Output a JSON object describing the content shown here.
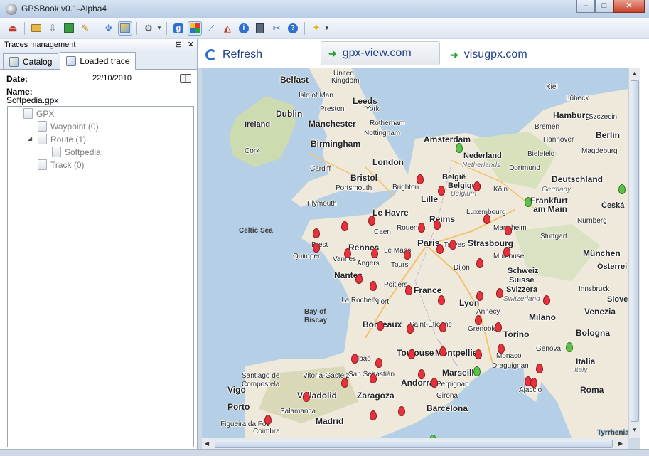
{
  "window": {
    "title": "GPSBook v0.1-Alpha4",
    "controls": {
      "minimize": "–",
      "maximize": "□",
      "close": "✕"
    }
  },
  "toolbar": {
    "buttons": [
      {
        "name": "exit-icon",
        "glyph": "⏏",
        "color": "#c0392b"
      },
      {
        "name": "open-folder-icon",
        "glyph": "▭",
        "color": "#d9a441"
      },
      {
        "name": "import-icon",
        "glyph": "⇩",
        "color": "#6b7c8f"
      },
      {
        "name": "export-icon",
        "glyph": "⇧",
        "color": "#2e8b3c"
      },
      {
        "name": "clean-icon",
        "glyph": "✎",
        "color": "#c98a1b"
      },
      {
        "name": "move-icon",
        "glyph": "✥",
        "color": "#2e6fd0"
      },
      {
        "name": "map-view-icon",
        "glyph": "▦",
        "color": "#d1a21b"
      },
      {
        "name": "plugins-icon",
        "glyph": "⚙",
        "color": "#555555"
      },
      {
        "name": "google-icon",
        "glyph": "g",
        "color": "#2e6fd0"
      },
      {
        "name": "tiles-icon",
        "glyph": "▩",
        "color": "#2aa336"
      },
      {
        "name": "chart-icon",
        "glyph": "📈",
        "color": "#2e6fd0"
      },
      {
        "name": "routes-icon",
        "glyph": "◭",
        "color": "#c0392b"
      },
      {
        "name": "info-icon",
        "glyph": "ℹ",
        "color": "#2e6fd0"
      },
      {
        "name": "calculator-icon",
        "glyph": "▤",
        "color": "#4a5866"
      },
      {
        "name": "tools-icon",
        "glyph": "✂",
        "color": "#4a77b6"
      },
      {
        "name": "help-icon",
        "glyph": "?",
        "color": "#2e6fd0"
      },
      {
        "name": "star-icon",
        "glyph": "✦",
        "color": "#e6b41a"
      }
    ]
  },
  "panel": {
    "title": "Traces management",
    "tabs": [
      {
        "label": "Catalog"
      },
      {
        "label": "Loaded trace"
      }
    ],
    "date_label": "Date:",
    "date_value": "22/10/2010",
    "name_label": "Name:",
    "name_value": "Softpedia.gpx",
    "tree": [
      {
        "label": "GPX"
      },
      {
        "label": "Waypoint (0)"
      },
      {
        "label": "Route (1)"
      },
      {
        "label": "Softpedia"
      },
      {
        "label": "Track (0)"
      }
    ]
  },
  "nav": {
    "refresh": "Refresh",
    "link1": "gpx-view.com",
    "link2": "visugpx.com"
  },
  "map": {
    "colors": {
      "sea": "#b5cfe6",
      "land": "#eee9da",
      "forest": "#cddbb0",
      "marker_red": "#e5323b",
      "marker_green": "#5ec24a"
    },
    "labels": {
      "united_kingdom": "United",
      "kingdom": "Kingdom",
      "belfast": "Belfast",
      "isle_of_man": "Isle of Man",
      "leeds": "Leeds",
      "preston": "Preston",
      "york": "York",
      "dublin": "Dublin",
      "ireland": "Ireland",
      "manchester": "Manchester",
      "rotherham": "Rotherham",
      "nottingham": "Nottingham",
      "cork": "Cork",
      "birmingham": "Birmingham",
      "cardiff": "Cardiff",
      "london": "London",
      "bristol": "Bristol",
      "portsmouth": "Portsmouth",
      "brighton": "Brighton",
      "plymouth": "Plymouth",
      "celtic_sea": "Celtic Sea",
      "amsterdam": "Amsterdam",
      "nederland": "Nederland",
      "netherlands": "Netherlands",
      "belgie": "België",
      "belgique": "Belgique",
      "belgium": "Belgium",
      "lille": "Lille",
      "koln": "Köln",
      "dortmund": "Dortmund",
      "bielefeld": "Bielefeld",
      "hamburg": "Hamburg",
      "kiel": "Kiel",
      "lubeck": "Lübeck",
      "bremen": "Bremen",
      "hannover": "Hannover",
      "berlin": "Berlin",
      "szczecin": "Szczecin",
      "magdeburg": "Magdeburg",
      "deutschland": "Deutschland",
      "germany": "Germany",
      "frankfurt": "Frankfurt",
      "am_main": "am Main",
      "ceska": "Česká",
      "luxembourg": "Luxembourg",
      "mannheim": "Mannheim",
      "nurnberg": "Nürnberg",
      "stuttgart": "Stuttgart",
      "munchen": "München",
      "osterreich": "Österrei",
      "schweiz": "Schweiz",
      "suisse": "Suisse",
      "svizzera": "Svizzera",
      "innsbruck": "Innsbruck",
      "switzerland": "Switzerland",
      "strasbourg": "Strasbourg",
      "mulhouse": "Mulhouse",
      "reims": "Reims",
      "paris": "Paris",
      "troyes": "Troyes",
      "le_havre": "Le Havre",
      "caen": "Caen",
      "rouen": "Rouen",
      "rennes": "Rennes",
      "le_mans": "Le Mans",
      "brest": "Brest",
      "quimper": "Quimper",
      "vannes": "Vannes",
      "angers": "Angers",
      "tours": "Tours",
      "nantes": "Nantes",
      "dijon": "Dijon",
      "france": "France",
      "poitiers": "Poitiers",
      "la_rochelle": "La Rochelle",
      "niort": "Niort",
      "lyon": "Lyon",
      "annecy": "Annecy",
      "bay_of_biscay_1": "Bay of",
      "bay_of_biscay_2": "Biscay",
      "bordeaux": "Bordeaux",
      "saint_etienne": "Saint-Étienne",
      "grenoble": "Grenoble",
      "milano": "Milano",
      "torino": "Torino",
      "venezia": "Venezia",
      "slove": "Slove",
      "genova": "Genova",
      "bologna": "Bologna",
      "monaco": "Monaco",
      "toulouse": "Toulouse",
      "montpellier": "Montpellier",
      "marseille": "Marseille",
      "draguignan": "Draguignan",
      "italia": "Italia",
      "italy": "Italy",
      "ajaccio": "Ajaccio",
      "roma": "Roma",
      "bilbao": "Bilbao",
      "san_sebastian": "San Sebastián",
      "vitoria": "Vitoria-Gasteiz",
      "santiago_1": "Santiago de",
      "santiago_2": "Compostela",
      "vigo": "Vigo",
      "valladolid": "Valladolid",
      "zaragoza": "Zaragoza",
      "andorra": "Andorra",
      "perpignan": "Perpignan",
      "girona": "Girona",
      "barcelona": "Barcelona",
      "porto": "Porto",
      "salamanca": "Salamanca",
      "madrid": "Madrid",
      "coimbra": "Coimbra",
      "figueira": "Figueira da Foz",
      "tyrrhenian": "Tyrrhenian",
      "nantes2": "Nantes"
    }
  }
}
